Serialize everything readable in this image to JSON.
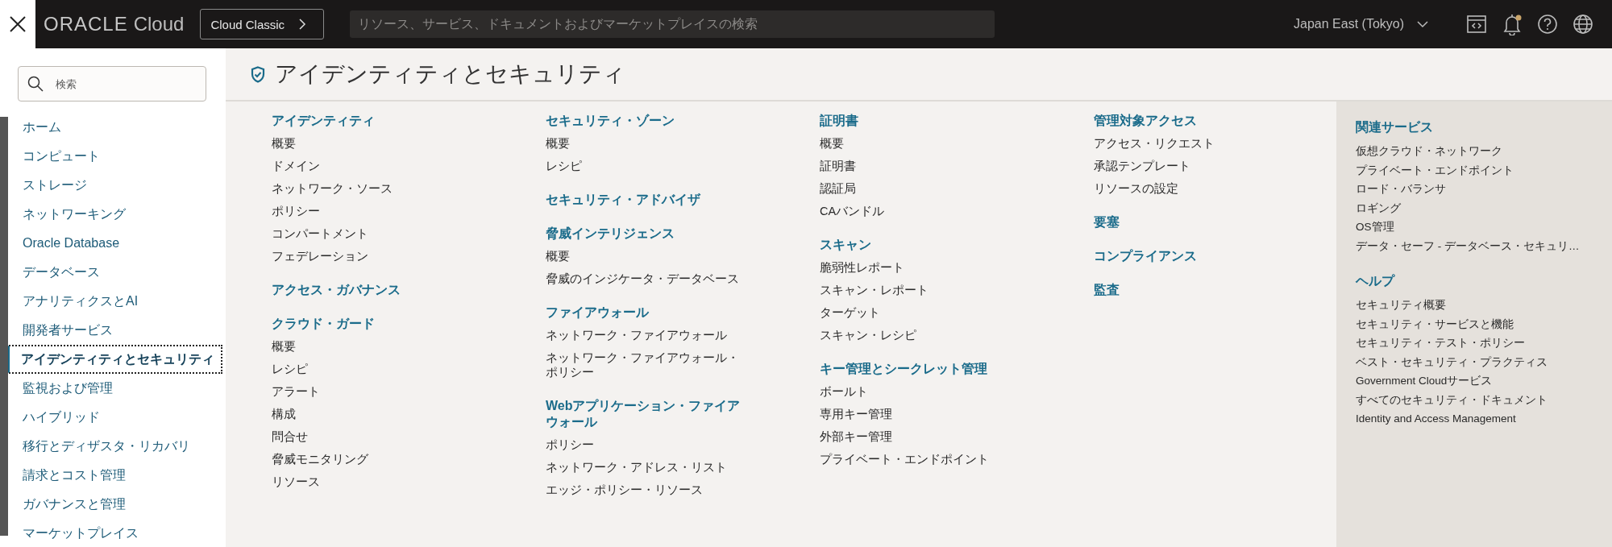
{
  "topbar": {
    "logo_word": "ORACLE",
    "logo_product": "Cloud",
    "classic_button": "Cloud Classic",
    "search": {
      "placeholder": "リソース、サービス、ドキュメントおよびマーケットプレイスの検索"
    },
    "region": "Japan East (Tokyo)",
    "notification_dot": true
  },
  "sidebar": {
    "search": {
      "placeholder": "検索"
    },
    "items": [
      {
        "label": "ホーム",
        "selected": false
      },
      {
        "label": "コンピュート",
        "selected": false
      },
      {
        "label": "ストレージ",
        "selected": false
      },
      {
        "label": "ネットワーキング",
        "selected": false
      },
      {
        "label": "Oracle Database",
        "selected": false
      },
      {
        "label": "データベース",
        "selected": false
      },
      {
        "label": "アナリティクスとAI",
        "selected": false
      },
      {
        "label": "開発者サービス",
        "selected": false
      },
      {
        "label": "アイデンティティとセキュリティ",
        "selected": true
      },
      {
        "label": "監視および管理",
        "selected": false
      },
      {
        "label": "ハイブリッド",
        "selected": false
      },
      {
        "label": "移行とディザスタ・リカバリ",
        "selected": false
      },
      {
        "label": "請求とコスト管理",
        "selected": false
      },
      {
        "label": "ガバナンスと管理",
        "selected": false
      },
      {
        "label": "マーケットプレイス",
        "selected": false
      }
    ]
  },
  "main": {
    "title": "アイデンティティとセキュリティ",
    "columns": [
      {
        "groups": [
          {
            "heading": "アイデンティティ",
            "items": [
              "概要",
              "ドメイン",
              "ネットワーク・ソース",
              "ポリシー",
              "コンパートメント",
              "フェデレーション"
            ]
          },
          {
            "heading": "アクセス・ガバナンス"
          },
          {
            "heading": "クラウド・ガード",
            "items": [
              "概要",
              "レシピ",
              "アラート",
              "構成",
              "問合せ",
              "脅威モニタリング",
              "リソース"
            ]
          }
        ]
      },
      {
        "groups": [
          {
            "heading": "セキュリティ・ゾーン",
            "items": [
              "概要",
              "レシピ"
            ]
          },
          {
            "heading": "セキュリティ・アドバイザ"
          },
          {
            "heading": "脅威インテリジェンス",
            "items": [
              "概要",
              "脅威のインジケータ・データベース"
            ]
          },
          {
            "heading": "ファイアウォール",
            "items": [
              "ネットワーク・ファイアウォール",
              "ネットワーク・ファイアウォール・ポリシー"
            ]
          },
          {
            "heading": "Webアプリケーション・ファイアウォール",
            "items": [
              "ポリシー",
              "ネットワーク・アドレス・リスト",
              "エッジ・ポリシー・リソース"
            ]
          }
        ]
      },
      {
        "groups": [
          {
            "heading": "証明書",
            "items": [
              "概要",
              "証明書",
              "認証局",
              "CAバンドル"
            ]
          },
          {
            "heading": "スキャン",
            "items": [
              "脆弱性レポート",
              "スキャン・レポート",
              "ターゲット",
              "スキャン・レシピ"
            ]
          },
          {
            "heading": "キー管理とシークレット管理",
            "items": [
              "ボールト",
              "専用キー管理",
              "外部キー管理",
              "プライベート・エンドポイント"
            ]
          }
        ]
      },
      {
        "groups": [
          {
            "heading": "管理対象アクセス",
            "items": [
              "アクセス・リクエスト",
              "承認テンプレート",
              "リソースの設定"
            ]
          },
          {
            "heading": "要塞"
          },
          {
            "heading": "コンプライアンス"
          },
          {
            "heading": "監査"
          }
        ]
      }
    ]
  },
  "related": {
    "sections": [
      {
        "heading": "関連サービス",
        "items": [
          "仮想クラウド・ネットワーク",
          "プライベート・エンドポイント",
          "ロード・バランサ",
          "ロギング",
          "OS管理",
          "データ・セーフ - データベース・セキュリ…"
        ]
      },
      {
        "heading": "ヘルプ",
        "items": [
          "セキュリティ概要",
          "セキュリティ・サービスと機能",
          "セキュリティ・テスト・ポリシー",
          "ベスト・セキュリティ・プラクティス",
          "Government Cloudサービス",
          "すべてのセキュリティ・ドキュメント",
          "Identity and Access Management"
        ]
      }
    ]
  }
}
